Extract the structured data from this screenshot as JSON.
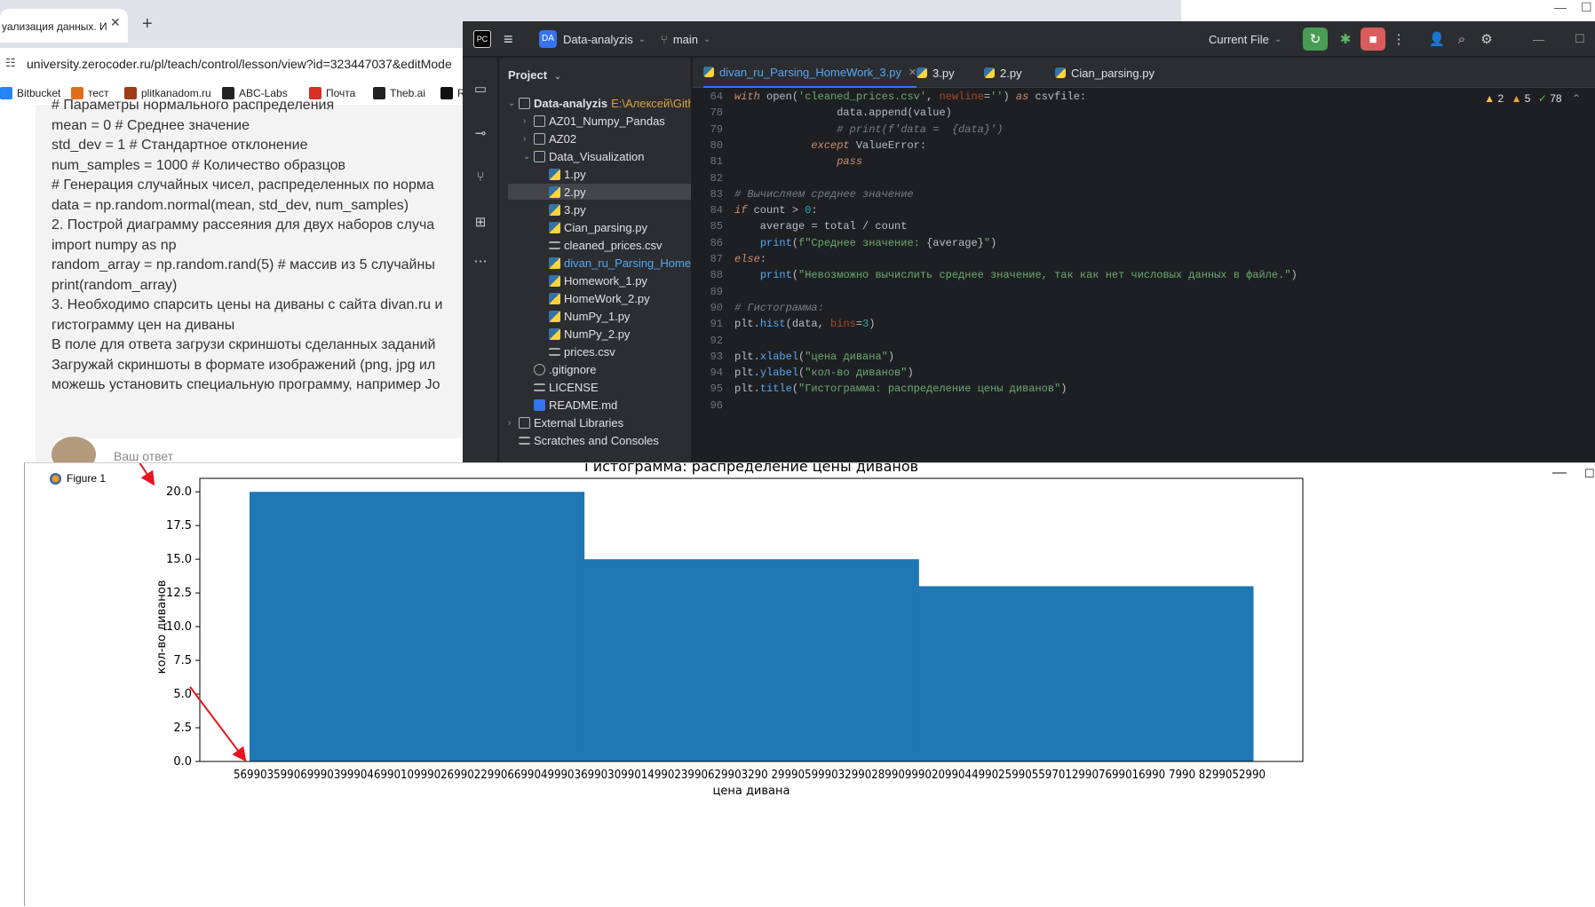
{
  "browser": {
    "tab_title": "уализация данных. И",
    "tab_close": "✕",
    "new_tab": "+",
    "url": "university.zerocoder.ru/pl/teach/control/lesson/view?id=323447037&editMode",
    "bookmarks": [
      "Bitbucket",
      "тест",
      "plitkanadom.ru",
      "ABC-Labs",
      "Почта",
      "Theb.ai",
      "R"
    ],
    "content_lines": [
      "# Параметры нормального распределения",
      "mean = 0 # Среднее значение",
      "std_dev = 1 # Стандартное отклонение",
      "num_samples = 1000 # Количество образцов",
      "# Генерация случайных чисел, распределенных по норма",
      "data = np.random.normal(mean, std_dev, num_samples)",
      "2. Построй диаграмму рассеяния для двух наборов случа",
      "import numpy as np",
      "random_array = np.random.rand(5) # массив из 5 случайны",
      "print(random_array)",
      "3. Необходимо спарсить цены на диваны с сайта divan.ru и",
      "гистограмму цен на диваны",
      "В поле для ответа загрузи скриншоты сделанных заданий",
      "Загружай скриншоты в формате изображений (png, jpg ил",
      "можешь установить специальную программу, например Jo"
    ],
    "answer_placeholder": "Ваш ответ"
  },
  "ide": {
    "logo": "PC",
    "project_badge": "DA",
    "project_name": "Data-analyzis",
    "branch": "main",
    "run_config": "Current File",
    "panel_title": "Project",
    "tree": [
      {
        "label": "Data-analyzis",
        "extra": "E:\\Алексей\\Githu",
        "kind": "folder",
        "depth": 0,
        "open": true
      },
      {
        "label": "AZ01_Numpy_Pandas",
        "kind": "folder",
        "depth": 1,
        "open": false
      },
      {
        "label": "AZ02",
        "kind": "folder",
        "depth": 1,
        "open": false
      },
      {
        "label": "Data_Visualization",
        "kind": "folder",
        "depth": 1,
        "open": true
      },
      {
        "label": "1.py",
        "kind": "py",
        "depth": 2
      },
      {
        "label": "2.py",
        "kind": "py",
        "depth": 2,
        "selected": true
      },
      {
        "label": "3.py",
        "kind": "py",
        "depth": 2
      },
      {
        "label": "Cian_parsing.py",
        "kind": "py",
        "depth": 2
      },
      {
        "label": "cleaned_prices.csv",
        "kind": "csv",
        "depth": 2
      },
      {
        "label": "divan_ru_Parsing_HomeW",
        "kind": "py",
        "depth": 2,
        "active": true
      },
      {
        "label": "Homework_1.py",
        "kind": "py",
        "depth": 2
      },
      {
        "label": "HomeWork_2.py",
        "kind": "py",
        "depth": 2
      },
      {
        "label": "NumPy_1.py",
        "kind": "py",
        "depth": 2
      },
      {
        "label": "NumPy_2.py",
        "kind": "py",
        "depth": 2
      },
      {
        "label": "prices.csv",
        "kind": "csv",
        "depth": 2
      },
      {
        "label": ".gitignore",
        "kind": "git",
        "depth": 1
      },
      {
        "label": "LICENSE",
        "kind": "txt",
        "depth": 1
      },
      {
        "label": "README.md",
        "kind": "md",
        "depth": 1
      },
      {
        "label": "External Libraries",
        "kind": "lib",
        "depth": 0,
        "open": false
      },
      {
        "label": "Scratches and Consoles",
        "kind": "scratch",
        "depth": 0
      }
    ],
    "tabs": [
      "divan_ru_Parsing_HomeWork_3.py",
      "3.py",
      "2.py",
      "Cian_parsing.py"
    ],
    "inspections": {
      "errors": "2",
      "warnings": "5",
      "ok": "78"
    },
    "code_lines": [
      {
        "n": "64",
        "html": "<span class='kw'>with</span> open(<span class='st'>'cleaned_prices.csv'</span>, <span class='pm'>newline</span>=<span class='st'>''</span>) <span class='kw'>as</span> csvfile:"
      },
      {
        "n": "78",
        "html": "                data.append(value)"
      },
      {
        "n": "79",
        "html": "                <span class='cm'># print(f'data =  {data}')</span>"
      },
      {
        "n": "80",
        "html": "            <span class='kw'>except</span> ValueError:"
      },
      {
        "n": "81",
        "html": "                <span class='kw'>pass</span>"
      },
      {
        "n": "82",
        "html": ""
      },
      {
        "n": "83",
        "html": "<span class='cm'># Вычисляем среднее значение</span>"
      },
      {
        "n": "84",
        "html": "<span class='kw'>if</span> count &gt; <span class='nm'>0</span>:"
      },
      {
        "n": "85",
        "html": "    average = total / count"
      },
      {
        "n": "86",
        "html": "    <span class='fn'>print</span>(<span class='st'>f\"Среднее значение: </span>{average}<span class='st'>\"</span>)"
      },
      {
        "n": "87",
        "html": "<span class='kw'>else</span>:"
      },
      {
        "n": "88",
        "html": "    <span class='fn'>print</span>(<span class='st'>\"Невозможно вычислить среднее значение, так как нет числовых данных в файле.\"</span>)"
      },
      {
        "n": "89",
        "html": ""
      },
      {
        "n": "90",
        "html": "<span class='cm'># Гистограмма:</span>"
      },
      {
        "n": "91",
        "html": "plt.<span class='fn'>hist</span>(data, <span class='pm'>bins</span>=<span class='nm'>3</span>)"
      },
      {
        "n": "92",
        "html": ""
      },
      {
        "n": "93",
        "html": "plt.<span class='fn'>xlabel</span>(<span class='st'>\"цена дивана\"</span>)"
      },
      {
        "n": "94",
        "html": "plt.<span class='fn'>ylabel</span>(<span class='st'>\"кол-во диванов\"</span>)"
      },
      {
        "n": "95",
        "html": "plt.<span class='fn'>title</span>(<span class='st'>\"Гистограмма: распределение цены диванов\"</span>)"
      },
      {
        "n": "96",
        "html": ""
      }
    ]
  },
  "figure": {
    "window_title": "Figure 1"
  },
  "chart_data": {
    "type": "bar",
    "title": "Гистограмма: распределение цены диванов",
    "xlabel": "цена дивана",
    "ylabel": "кол-во диванов",
    "ylim": [
      0,
      21
    ],
    "yticks": [
      "0.0",
      "2.5",
      "5.0",
      "7.5",
      "10.0",
      "12.5",
      "15.0",
      "17.5",
      "20.0"
    ],
    "values": [
      20,
      15,
      13
    ],
    "bar_color": "#1f77b4",
    "xtick_labels": "56990359906999039990469901099902699022990669904999036990309901499023990629903290 29990599903299028990999020990449902599055970129907699016990 7990 8299052990",
    "annotation_color": "#e8141c"
  }
}
